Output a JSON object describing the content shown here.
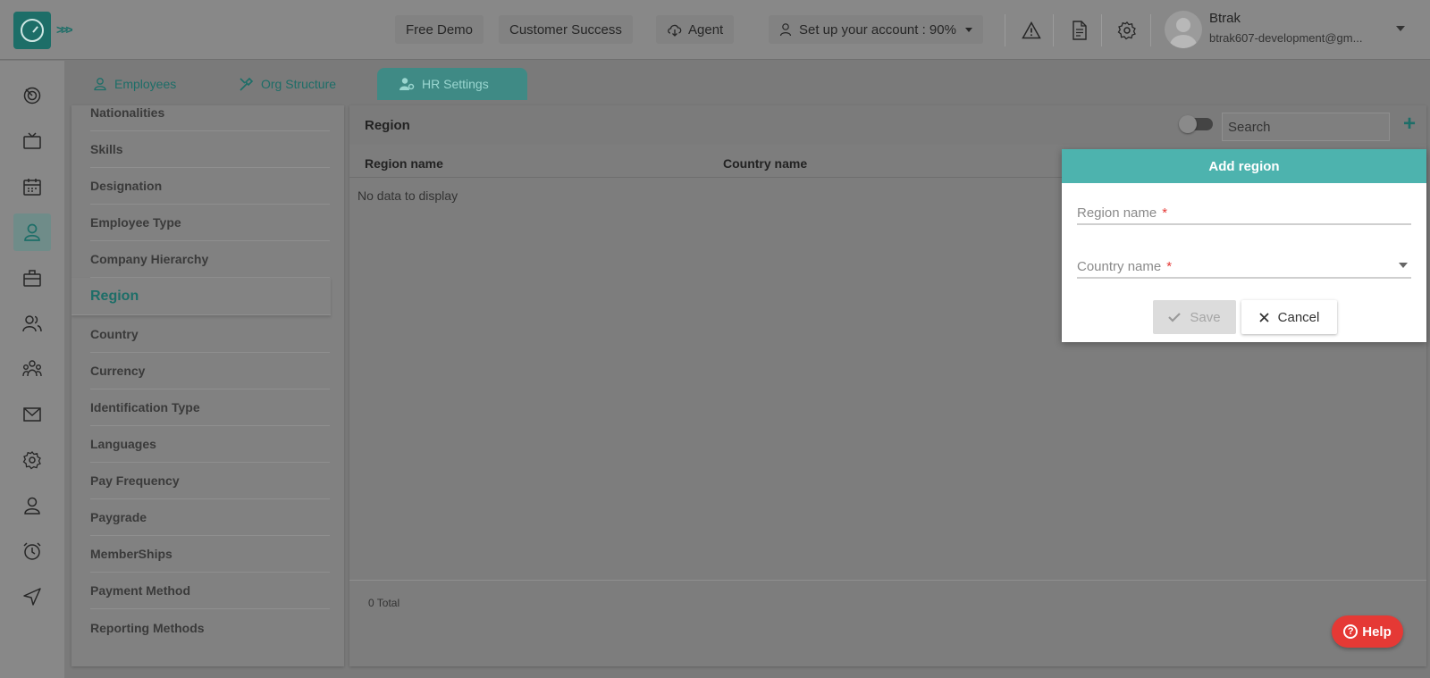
{
  "topbar": {
    "free_demo": "Free Demo",
    "customer_success": "Customer Success",
    "agent": "Agent",
    "setup_account": "Set up your account : 90%",
    "user_name": "Btrak",
    "user_email": "btrak607-development@gm..."
  },
  "tabs": {
    "employees": "Employees",
    "org_structure": "Org Structure",
    "hr_settings": "HR Settings"
  },
  "settings_list": {
    "items": [
      "Nationalities",
      "Skills",
      "Designation",
      "Employee Type",
      "Company Hierarchy",
      "Region",
      "Country",
      "Currency",
      "Identification Type",
      "Languages",
      "Pay Frequency",
      "Paygrade",
      "MemberShips",
      "Payment Method",
      "Reporting Methods"
    ],
    "active_item": "Region"
  },
  "main": {
    "title": "Region",
    "search_placeholder": "Search",
    "columns": [
      "Region name",
      "Country name"
    ],
    "empty_message": "No data to display",
    "total": "0 Total"
  },
  "popup": {
    "title": "Add region",
    "region_label": "Region name",
    "country_label": "Country name",
    "required_mark": "*",
    "save_label": "Save",
    "cancel_label": "Cancel"
  },
  "help": {
    "label": "Help"
  },
  "colors": {
    "brand": "#1d6e68",
    "popup_header": "#4db3ae",
    "help": "#e53935"
  }
}
